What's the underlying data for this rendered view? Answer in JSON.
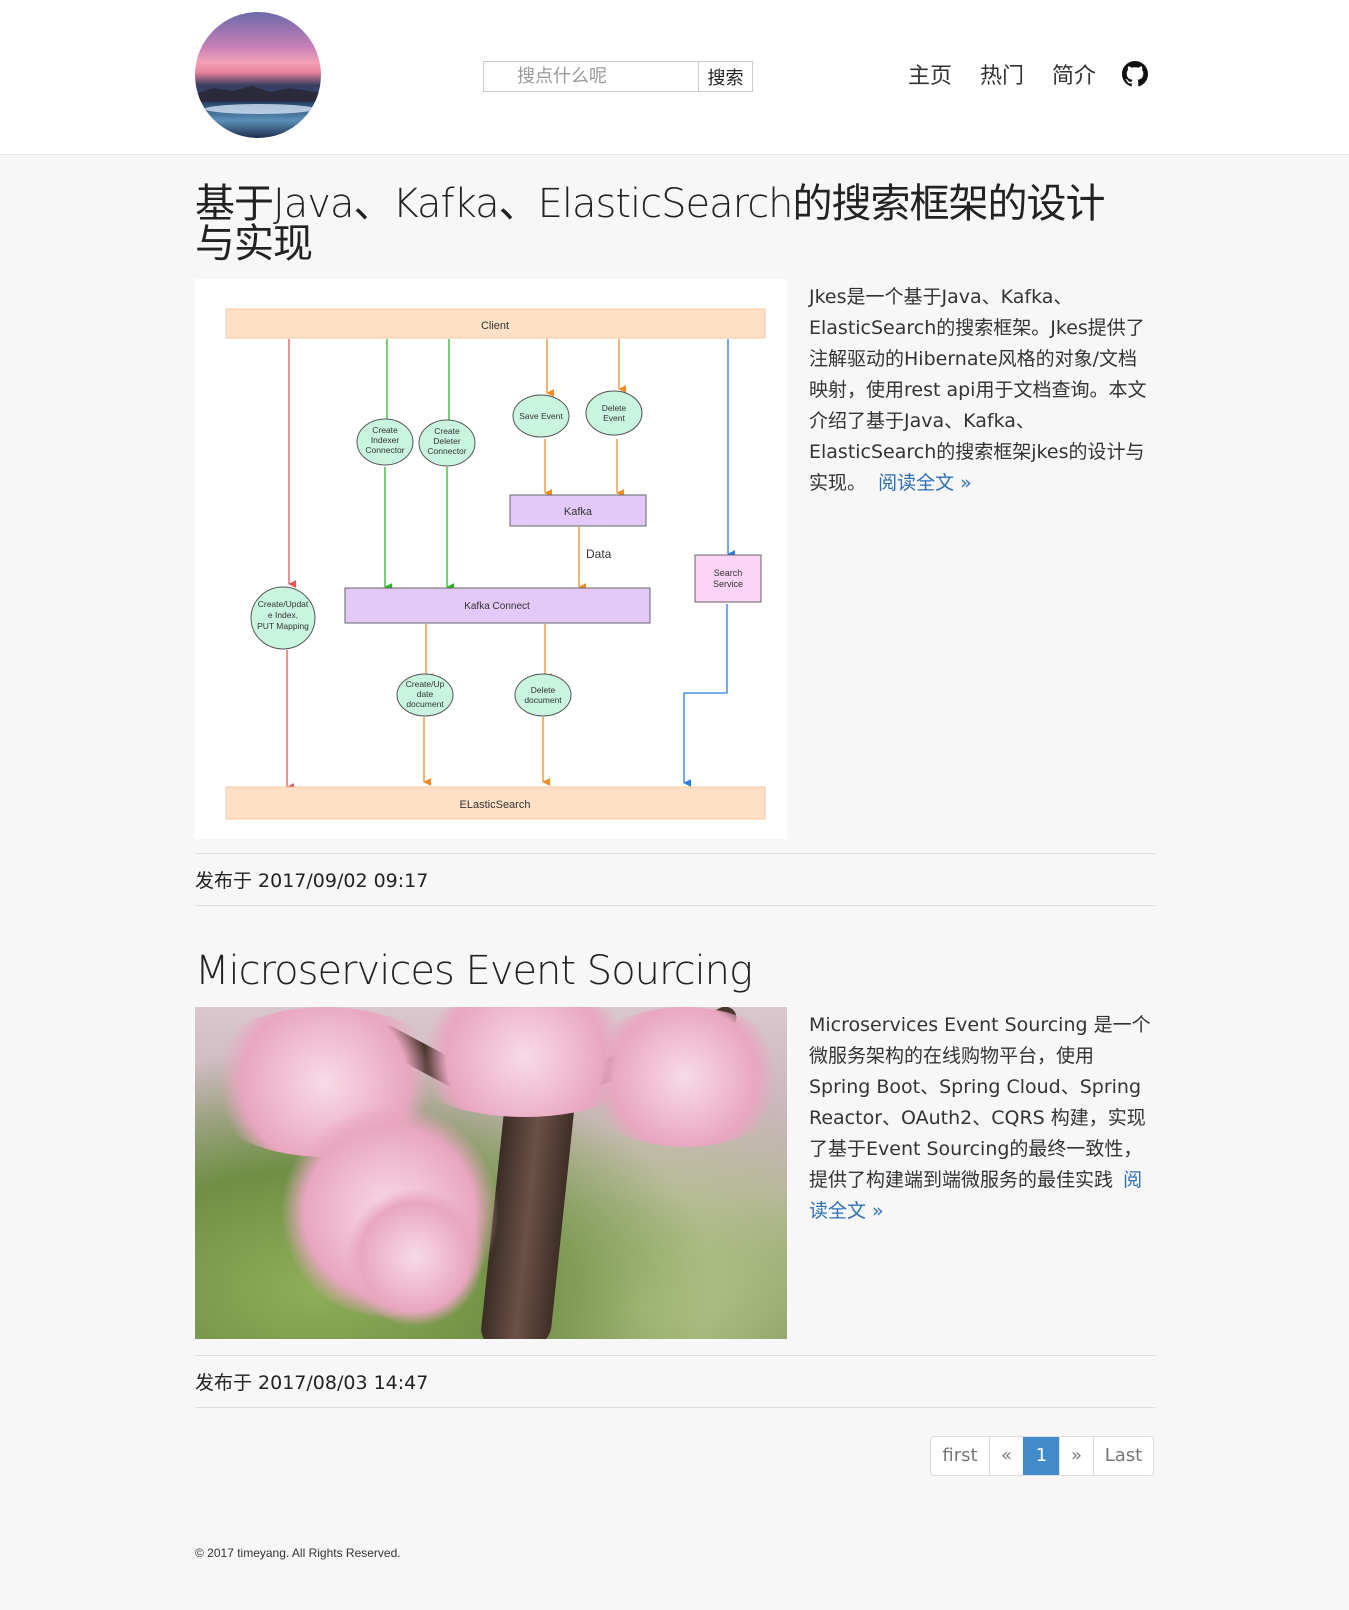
{
  "header": {
    "search": {
      "placeholder": "搜点什么呢",
      "button_label": "搜索"
    },
    "nav": [
      {
        "label": "主页"
      },
      {
        "label": "热门"
      },
      {
        "label": "简介"
      }
    ],
    "github_icon": "github-icon"
  },
  "posts": [
    {
      "title": "基于Java、Kafka、ElasticSearch的搜索框架的设计与实现",
      "excerpt": "Jkes是一个基于Java、Kafka、ElasticSearch的搜索框架。Jkes提供了注解驱动的Hibernate风格的对象/文档映射，使用rest api用于文档查询。本文介绍了基于Java、Kafka、ElasticSearch的搜索框架jkes的设计与实现。",
      "read_more": "阅读全文 »",
      "meta": "发布于 2017/09/02 09:17",
      "diagram": {
        "client": "Client",
        "elasticsearch": "ELasticSearch",
        "kafka": "Kafka",
        "kafka_connect": "Kafka Connect",
        "data_label": "Data",
        "search_service": [
          "Search",
          "Service"
        ],
        "save_event": "Save Event",
        "delete_event": [
          "Delete",
          "Event"
        ],
        "create_indexer": [
          "Create",
          "Indexer",
          "Connector"
        ],
        "create_deleter": [
          "Create",
          "Deleter",
          "Connector"
        ],
        "create_update_index": [
          "Create/Updat",
          "e Index,",
          "PUT Mapping"
        ],
        "create_update_document": [
          "Create/Up",
          "date",
          "document"
        ],
        "delete_document": [
          "Delete",
          "document"
        ]
      }
    },
    {
      "title": "Microservices Event Sourcing",
      "excerpt": "Microservices Event Sourcing 是一个微服务架构的在线购物平台，使用 Spring Boot、Spring Cloud、Spring Reactor、OAuth2、CQRS 构建，实现了基于Event Sourcing的最终一致性，提供了构建端到端微服务的最佳实践",
      "read_more": "阅读全文 »",
      "meta": "发布于 2017/08/03 14:47"
    }
  ],
  "pagination": {
    "first": "first",
    "prev": "«",
    "current": "1",
    "next": "»",
    "last": "Last"
  },
  "footer": {
    "copyright": "© 2017 timeyang. All Rights Reserved."
  },
  "colors": {
    "link": "#2c6fb5",
    "pager_active": "#428bca"
  }
}
